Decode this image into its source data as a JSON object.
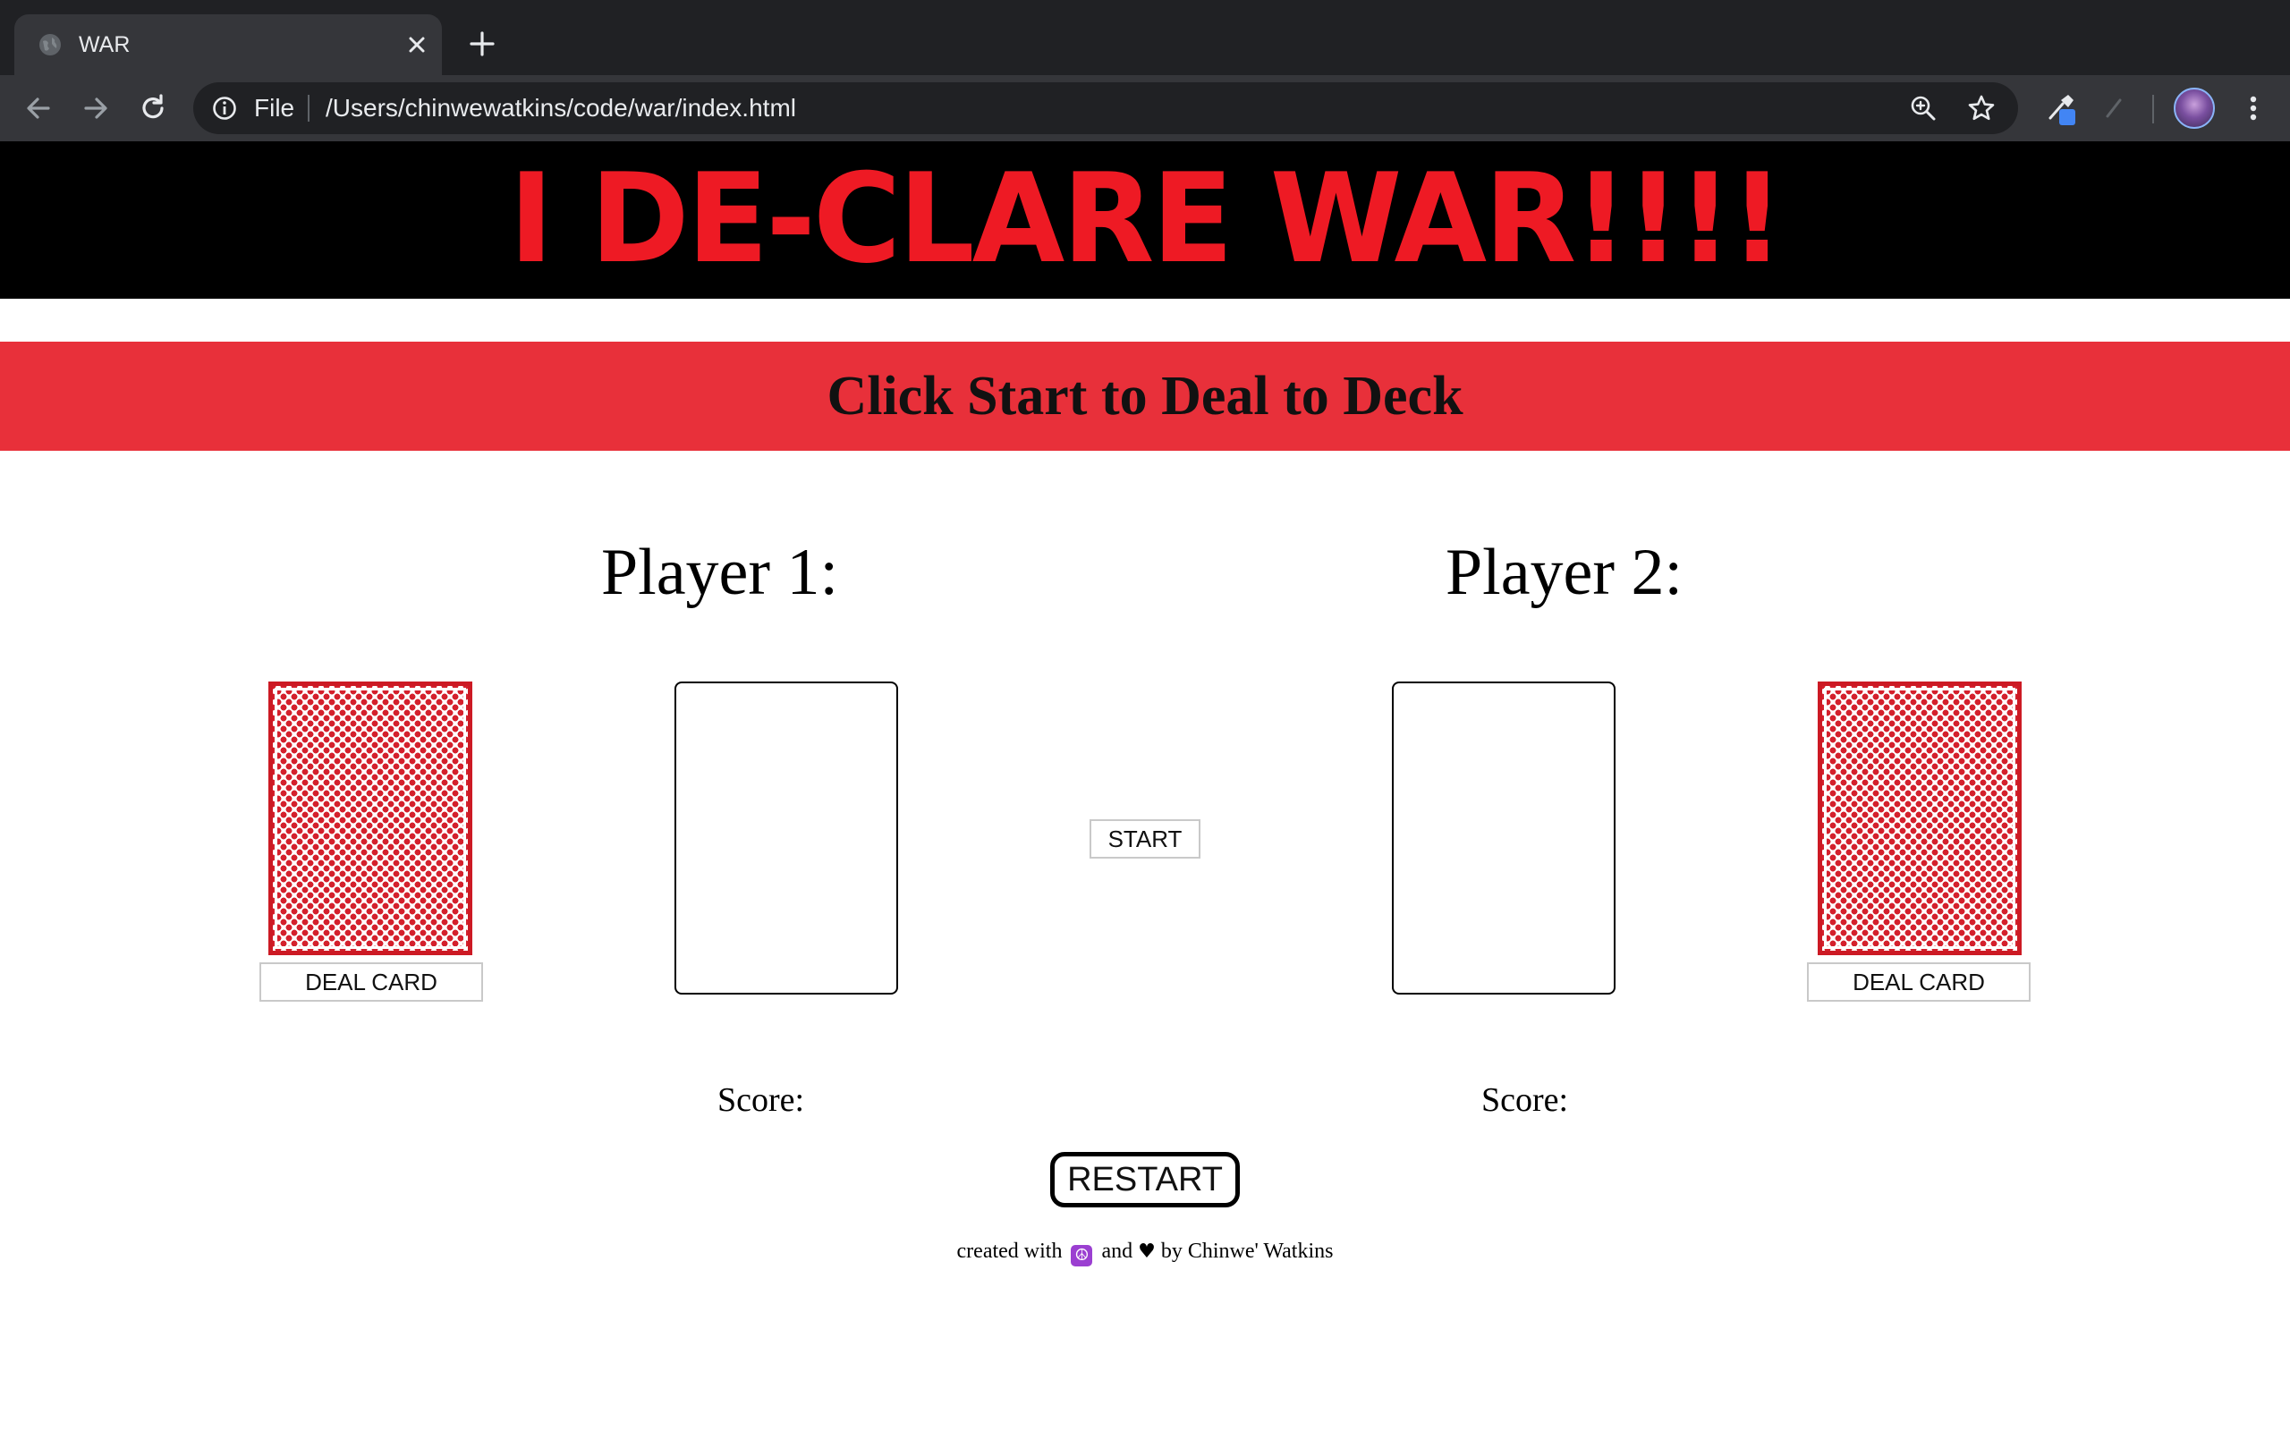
{
  "browser": {
    "tab": {
      "title": "WAR"
    },
    "omnibox": {
      "scheme_label": "File",
      "url": "/Users/chinwewatkins/code/war/index.html"
    },
    "icons": [
      "globe-icon",
      "close-icon",
      "plus-icon",
      "back-arrow-icon",
      "forward-arrow-icon",
      "reload-icon",
      "info-icon",
      "zoom-icon",
      "star-icon",
      "eyedropper-icon",
      "puzzle-icon",
      "avatar",
      "menu-dots-icon"
    ]
  },
  "page": {
    "banner_title": "I DE-CLARE WAR!!!!",
    "status_message": "Click Start to Deal to Deck",
    "player1": {
      "title": "Player 1:",
      "deal_label": "DEAL CARD",
      "score_label": "Score:"
    },
    "player2": {
      "title": "Player 2:",
      "deal_label": "DEAL CARD",
      "score_label": "Score:"
    },
    "start_label": "START",
    "restart_label": "RESTART",
    "footer": {
      "created_with": "created with",
      "peace_symbol": "☮",
      "and_text": "and",
      "heart_symbol": "♥",
      "by_text": "by Chinwe' Watkins"
    }
  },
  "colors": {
    "banner_bg": "#000000",
    "banner_text": "#ee1a24",
    "status_bar_bg": "#e8303a",
    "card_back": "#d4202c",
    "chrome_dark": "#202124",
    "chrome_toolbar": "#35363a"
  }
}
